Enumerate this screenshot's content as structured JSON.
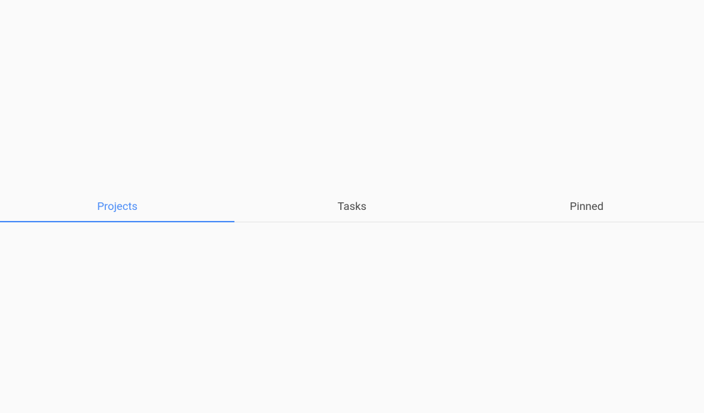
{
  "tabs": [
    {
      "label": "Projects",
      "active": true
    },
    {
      "label": "Tasks",
      "active": false
    },
    {
      "label": "Pinned",
      "active": false
    }
  ]
}
